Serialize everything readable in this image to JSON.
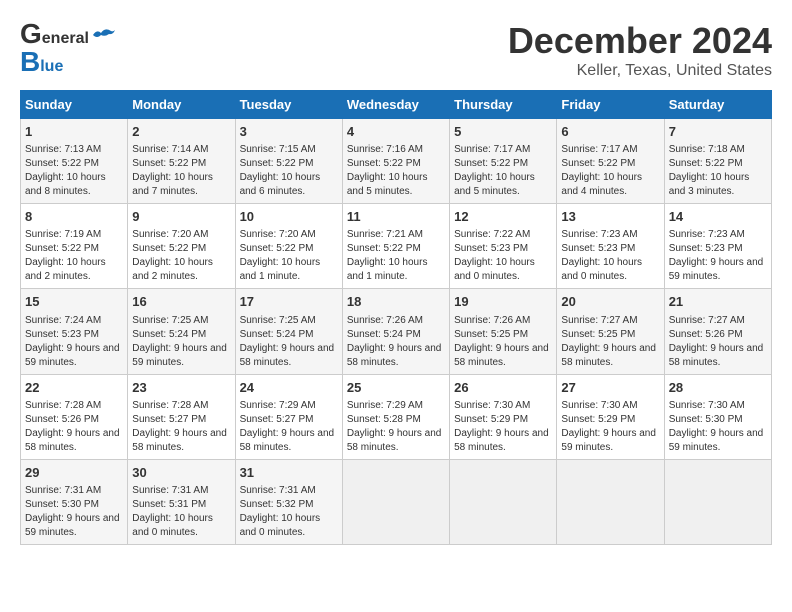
{
  "header": {
    "logo_line1": "General",
    "logo_line2": "Blue",
    "month": "December 2024",
    "location": "Keller, Texas, United States"
  },
  "days_of_week": [
    "Sunday",
    "Monday",
    "Tuesday",
    "Wednesday",
    "Thursday",
    "Friday",
    "Saturday"
  ],
  "weeks": [
    [
      {
        "num": "1",
        "sunrise": "Sunrise: 7:13 AM",
        "sunset": "Sunset: 5:22 PM",
        "daylight": "Daylight: 10 hours and 8 minutes."
      },
      {
        "num": "2",
        "sunrise": "Sunrise: 7:14 AM",
        "sunset": "Sunset: 5:22 PM",
        "daylight": "Daylight: 10 hours and 7 minutes."
      },
      {
        "num": "3",
        "sunrise": "Sunrise: 7:15 AM",
        "sunset": "Sunset: 5:22 PM",
        "daylight": "Daylight: 10 hours and 6 minutes."
      },
      {
        "num": "4",
        "sunrise": "Sunrise: 7:16 AM",
        "sunset": "Sunset: 5:22 PM",
        "daylight": "Daylight: 10 hours and 5 minutes."
      },
      {
        "num": "5",
        "sunrise": "Sunrise: 7:17 AM",
        "sunset": "Sunset: 5:22 PM",
        "daylight": "Daylight: 10 hours and 5 minutes."
      },
      {
        "num": "6",
        "sunrise": "Sunrise: 7:17 AM",
        "sunset": "Sunset: 5:22 PM",
        "daylight": "Daylight: 10 hours and 4 minutes."
      },
      {
        "num": "7",
        "sunrise": "Sunrise: 7:18 AM",
        "sunset": "Sunset: 5:22 PM",
        "daylight": "Daylight: 10 hours and 3 minutes."
      }
    ],
    [
      {
        "num": "8",
        "sunrise": "Sunrise: 7:19 AM",
        "sunset": "Sunset: 5:22 PM",
        "daylight": "Daylight: 10 hours and 2 minutes."
      },
      {
        "num": "9",
        "sunrise": "Sunrise: 7:20 AM",
        "sunset": "Sunset: 5:22 PM",
        "daylight": "Daylight: 10 hours and 2 minutes."
      },
      {
        "num": "10",
        "sunrise": "Sunrise: 7:20 AM",
        "sunset": "Sunset: 5:22 PM",
        "daylight": "Daylight: 10 hours and 1 minute."
      },
      {
        "num": "11",
        "sunrise": "Sunrise: 7:21 AM",
        "sunset": "Sunset: 5:22 PM",
        "daylight": "Daylight: 10 hours and 1 minute."
      },
      {
        "num": "12",
        "sunrise": "Sunrise: 7:22 AM",
        "sunset": "Sunset: 5:23 PM",
        "daylight": "Daylight: 10 hours and 0 minutes."
      },
      {
        "num": "13",
        "sunrise": "Sunrise: 7:23 AM",
        "sunset": "Sunset: 5:23 PM",
        "daylight": "Daylight: 10 hours and 0 minutes."
      },
      {
        "num": "14",
        "sunrise": "Sunrise: 7:23 AM",
        "sunset": "Sunset: 5:23 PM",
        "daylight": "Daylight: 9 hours and 59 minutes."
      }
    ],
    [
      {
        "num": "15",
        "sunrise": "Sunrise: 7:24 AM",
        "sunset": "Sunset: 5:23 PM",
        "daylight": "Daylight: 9 hours and 59 minutes."
      },
      {
        "num": "16",
        "sunrise": "Sunrise: 7:25 AM",
        "sunset": "Sunset: 5:24 PM",
        "daylight": "Daylight: 9 hours and 59 minutes."
      },
      {
        "num": "17",
        "sunrise": "Sunrise: 7:25 AM",
        "sunset": "Sunset: 5:24 PM",
        "daylight": "Daylight: 9 hours and 58 minutes."
      },
      {
        "num": "18",
        "sunrise": "Sunrise: 7:26 AM",
        "sunset": "Sunset: 5:24 PM",
        "daylight": "Daylight: 9 hours and 58 minutes."
      },
      {
        "num": "19",
        "sunrise": "Sunrise: 7:26 AM",
        "sunset": "Sunset: 5:25 PM",
        "daylight": "Daylight: 9 hours and 58 minutes."
      },
      {
        "num": "20",
        "sunrise": "Sunrise: 7:27 AM",
        "sunset": "Sunset: 5:25 PM",
        "daylight": "Daylight: 9 hours and 58 minutes."
      },
      {
        "num": "21",
        "sunrise": "Sunrise: 7:27 AM",
        "sunset": "Sunset: 5:26 PM",
        "daylight": "Daylight: 9 hours and 58 minutes."
      }
    ],
    [
      {
        "num": "22",
        "sunrise": "Sunrise: 7:28 AM",
        "sunset": "Sunset: 5:26 PM",
        "daylight": "Daylight: 9 hours and 58 minutes."
      },
      {
        "num": "23",
        "sunrise": "Sunrise: 7:28 AM",
        "sunset": "Sunset: 5:27 PM",
        "daylight": "Daylight: 9 hours and 58 minutes."
      },
      {
        "num": "24",
        "sunrise": "Sunrise: 7:29 AM",
        "sunset": "Sunset: 5:27 PM",
        "daylight": "Daylight: 9 hours and 58 minutes."
      },
      {
        "num": "25",
        "sunrise": "Sunrise: 7:29 AM",
        "sunset": "Sunset: 5:28 PM",
        "daylight": "Daylight: 9 hours and 58 minutes."
      },
      {
        "num": "26",
        "sunrise": "Sunrise: 7:30 AM",
        "sunset": "Sunset: 5:29 PM",
        "daylight": "Daylight: 9 hours and 58 minutes."
      },
      {
        "num": "27",
        "sunrise": "Sunrise: 7:30 AM",
        "sunset": "Sunset: 5:29 PM",
        "daylight": "Daylight: 9 hours and 59 minutes."
      },
      {
        "num": "28",
        "sunrise": "Sunrise: 7:30 AM",
        "sunset": "Sunset: 5:30 PM",
        "daylight": "Daylight: 9 hours and 59 minutes."
      }
    ],
    [
      {
        "num": "29",
        "sunrise": "Sunrise: 7:31 AM",
        "sunset": "Sunset: 5:30 PM",
        "daylight": "Daylight: 9 hours and 59 minutes."
      },
      {
        "num": "30",
        "sunrise": "Sunrise: 7:31 AM",
        "sunset": "Sunset: 5:31 PM",
        "daylight": "Daylight: 10 hours and 0 minutes."
      },
      {
        "num": "31",
        "sunrise": "Sunrise: 7:31 AM",
        "sunset": "Sunset: 5:32 PM",
        "daylight": "Daylight: 10 hours and 0 minutes."
      },
      null,
      null,
      null,
      null
    ]
  ]
}
